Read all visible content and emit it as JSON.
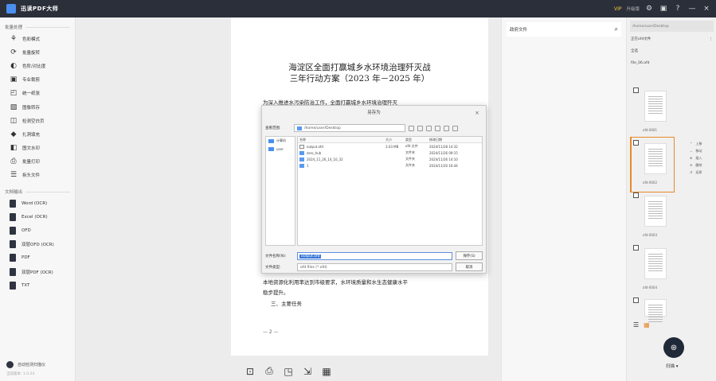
{
  "app": {
    "name": "迅读PDF大师",
    "vip": "VIP",
    "login": "升级版"
  },
  "sidebar": {
    "group1_label": "批量处理",
    "items": [
      {
        "label": "色彩模式",
        "icon": "palette-icon",
        "glyph": "⚘"
      },
      {
        "label": "批量旋转",
        "icon": "rotate-icon",
        "glyph": "⟳"
      },
      {
        "label": "色阶/对比度",
        "icon": "contrast-icon",
        "glyph": "◐"
      },
      {
        "label": "专业裁剪",
        "icon": "crop-icon",
        "glyph": "▣"
      },
      {
        "label": "统一纸张",
        "icon": "paper-icon",
        "glyph": "◰"
      },
      {
        "label": "图像转存",
        "icon": "image-save-icon",
        "glyph": "▧"
      },
      {
        "label": "检测空白页",
        "icon": "blank-page-icon",
        "glyph": "◫"
      },
      {
        "label": "扎洞填充",
        "icon": "fill-icon",
        "glyph": "◆"
      },
      {
        "label": "图文水印",
        "icon": "watermark-icon",
        "glyph": "◧"
      },
      {
        "label": "批量打印",
        "icon": "print-icon",
        "glyph": "⎙"
      },
      {
        "label": "拆头文件",
        "icon": "split-icon",
        "glyph": "☰"
      }
    ],
    "group2_label": "文档输出",
    "formats": [
      {
        "label": "Word (OCR)"
      },
      {
        "label": "Excel (OCR)"
      },
      {
        "label": "OFD"
      },
      {
        "label": "双层OFD (OCR)"
      },
      {
        "label": "PDF"
      },
      {
        "label": "双层PDF (OCR)"
      },
      {
        "label": "TXT"
      }
    ],
    "footer_label": "自动检测扫描仪",
    "footer_version": "当前版本: 1.0.24"
  },
  "document": {
    "title_line1": "海淀区全面打赢城乡水环境治理歼灭战",
    "title_line2": "三年行动方案（2023 年－2025 年）",
    "intro": "为深入推进水污染防治工作，全面打赢城乡水环境治理歼灭",
    "body1": "本地资源化利用率达到市级要求，水环境质量和水生态健康水平",
    "body2": "稳步提升。",
    "section": "三、主要任务",
    "page_num": "— 2 —"
  },
  "dialog": {
    "title": "另存为",
    "lookin_label": "查看范围:",
    "lookin_value": "/home/user/Desktop",
    "places": [
      "计算机",
      "user"
    ],
    "columns": {
      "name": "名称",
      "size": "大小",
      "type": "类型",
      "date": "修改日期"
    },
    "files": [
      {
        "name": "output.ofd",
        "size": "3.03 MB",
        "type": "ofd 文件",
        "date": "2024/11/28 14:32",
        "kind": "file"
      },
      {
        "name": "zero_hub",
        "size": "",
        "type": "文件夹",
        "date": "2024/11/26 09:15",
        "kind": "folder"
      },
      {
        "name": "2024_11_26_14_10_32",
        "size": "",
        "type": "文件夹",
        "date": "2024/11/26 14:10",
        "kind": "folder"
      },
      {
        "name": "1",
        "size": "",
        "type": "文件夹",
        "date": "2024/11/20 16:44",
        "kind": "folder"
      }
    ],
    "filename_label": "文件名称(N):",
    "filename_value": "output.ofd",
    "filetype_label": "文件类型:",
    "filetype_value": "ofd files (*.ofd)",
    "save_label": "保存(S)",
    "cancel_label": "取消"
  },
  "docbar": {
    "tools": [
      {
        "name": "fit-page-icon",
        "glyph": "⊡"
      },
      {
        "name": "print-icon",
        "glyph": "⎙"
      },
      {
        "name": "ocr-icon",
        "glyph": "◳"
      },
      {
        "name": "export-icon",
        "glyph": "⇲"
      },
      {
        "name": "grid-icon",
        "glyph": "▦"
      }
    ]
  },
  "right_panel": {
    "search_label": "政府文件"
  },
  "thumbs": {
    "path": "/home/user/Desktop",
    "open_label": "正在ofd文件",
    "select_all": "全选",
    "file_label": "file_06.ofd",
    "names": [
      "ofd-0001",
      "ofd-0002",
      "ofd-0003",
      "ofd-0004"
    ],
    "tools": [
      "上移",
      "移动",
      "插入",
      "删除",
      "还原"
    ],
    "scan_label": "扫描"
  }
}
